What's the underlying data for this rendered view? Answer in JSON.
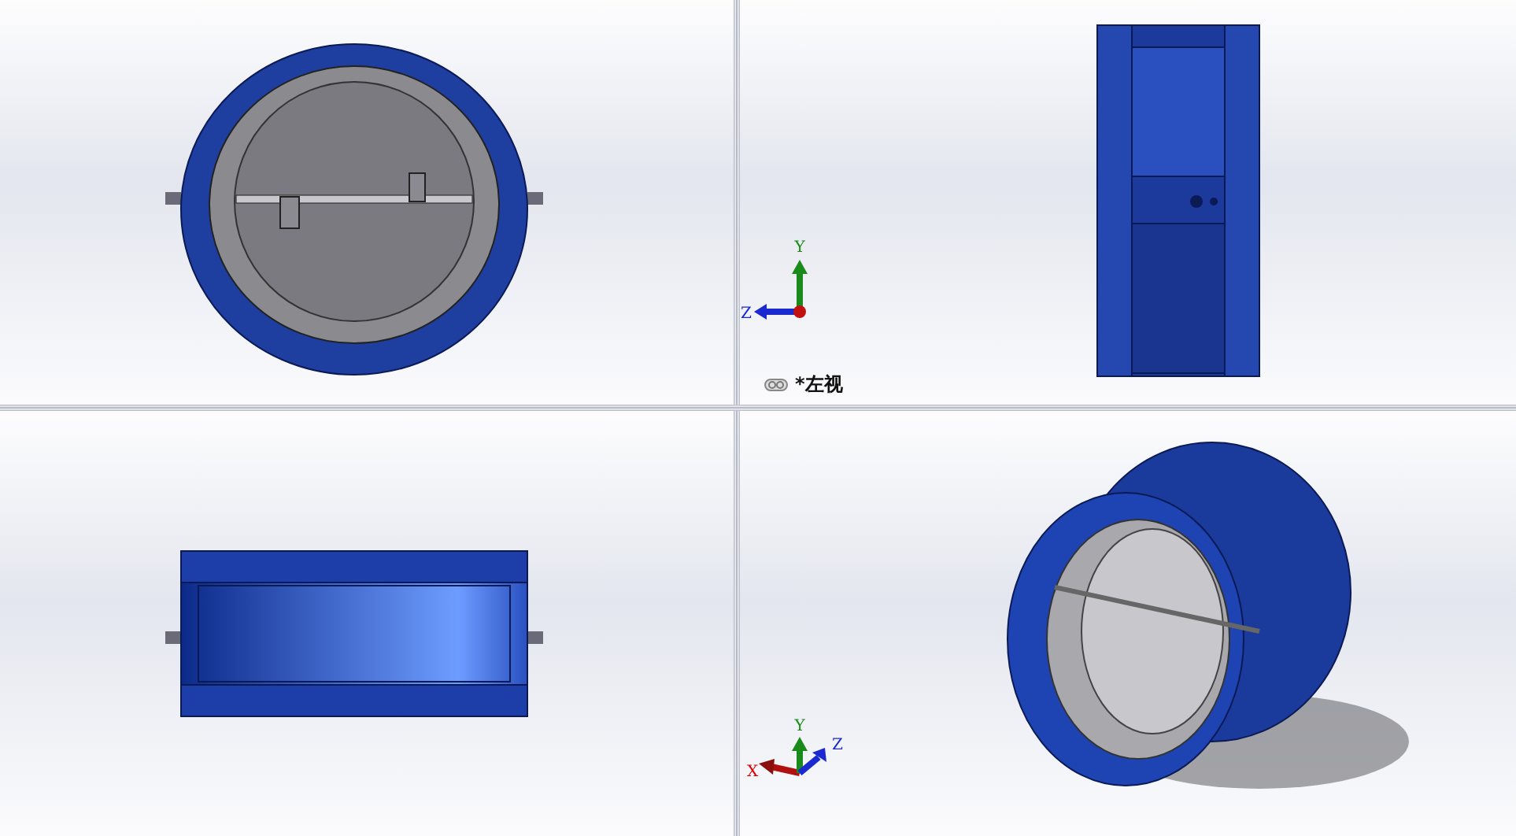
{
  "viewports": [
    {
      "kind": "front"
    },
    {
      "kind": "side",
      "triad": {
        "kind": "planar",
        "axes": [
          "Y",
          "Z"
        ]
      },
      "view_label": "*左视"
    },
    {
      "kind": "top"
    },
    {
      "kind": "iso",
      "triad": {
        "kind": "spatial",
        "axes": [
          "X",
          "Y",
          "Z"
        ]
      }
    }
  ]
}
